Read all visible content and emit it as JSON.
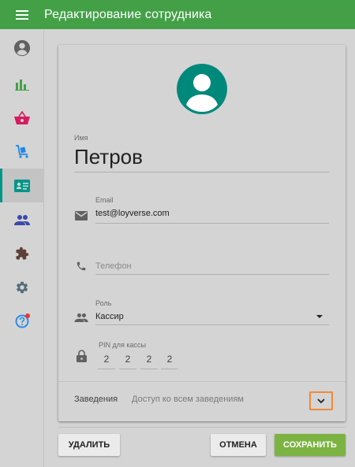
{
  "header": {
    "title": "Редактирование сотрудника"
  },
  "employee": {
    "name_label": "Имя",
    "name": "Петров",
    "email_label": "Email",
    "email": "test@loyverse.com",
    "phone_placeholder": "Телефон",
    "role_label": "Роль",
    "role": "Кассир",
    "pin_label": "PIN для кассы",
    "pin": [
      "2",
      "2",
      "2",
      "2"
    ]
  },
  "venues": {
    "label": "Заведения",
    "value": "Доступ ко всем заведениям"
  },
  "actions": {
    "delete": "Удалить",
    "cancel": "Отмена",
    "save": "Сохранить"
  },
  "colors": {
    "topbar": "#43a047",
    "accent": "#009688",
    "avatar": "#00897b",
    "save": "#7cb342",
    "focus_outline": "#f0893a"
  }
}
